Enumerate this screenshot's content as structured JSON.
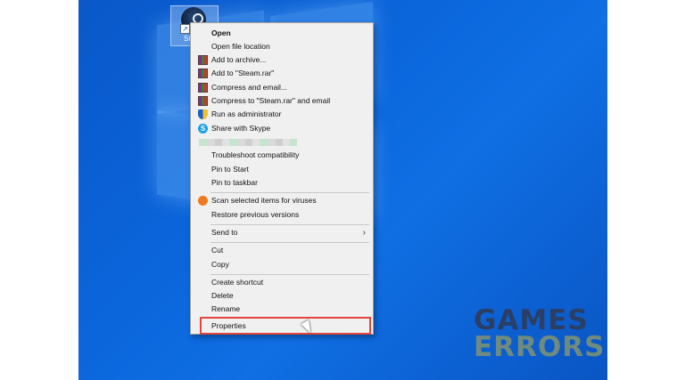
{
  "desktop": {
    "icon_label": "St",
    "icon_name": "steam-icon"
  },
  "context_menu": {
    "items": [
      {
        "label": "Open",
        "bold": true,
        "icon": ""
      },
      {
        "label": "Open file location",
        "icon": ""
      },
      {
        "label": "Add to archive...",
        "icon": "winrar-icon"
      },
      {
        "label": "Add to \"Steam.rar\"",
        "icon": "winrar-icon"
      },
      {
        "label": "Compress and email...",
        "icon": "winrar-icon"
      },
      {
        "label": "Compress to \"Steam.rar\" and email",
        "icon": "winrar-icon"
      },
      {
        "label": "Run as administrator",
        "icon": "uac-shield-icon"
      },
      {
        "label": "Share with Skype",
        "icon": "skype-icon"
      },
      {
        "label": "",
        "icon": "blurred-item"
      },
      {
        "label": "Troubleshoot compatibility",
        "icon": ""
      },
      {
        "label": "Pin to Start",
        "icon": ""
      },
      {
        "label": "Pin to taskbar",
        "icon": ""
      },
      {
        "label": "Scan selected items for viruses",
        "icon": "avast-icon"
      },
      {
        "label": "Restore previous versions",
        "icon": ""
      },
      {
        "label": "Send to",
        "icon": "",
        "submenu": true
      },
      {
        "label": "Cut",
        "icon": ""
      },
      {
        "label": "Copy",
        "icon": ""
      },
      {
        "label": "Create shortcut",
        "icon": ""
      },
      {
        "label": "Delete",
        "icon": ""
      },
      {
        "label": "Rename",
        "icon": ""
      },
      {
        "label": "Properties",
        "icon": "",
        "highlighted": true
      }
    ],
    "submenu_glyph": "›",
    "skype_glyph": "S",
    "shortcut_glyph": "↗"
  },
  "watermark": {
    "line1": "GAMES",
    "line2": "ERRORS"
  },
  "colors": {
    "desktop": "#0b66dc",
    "menu_bg": "#f0f0f0",
    "highlight": "#e0463a",
    "watermark_dark": "#2b3f66",
    "watermark_light": "#6f8a7e"
  }
}
